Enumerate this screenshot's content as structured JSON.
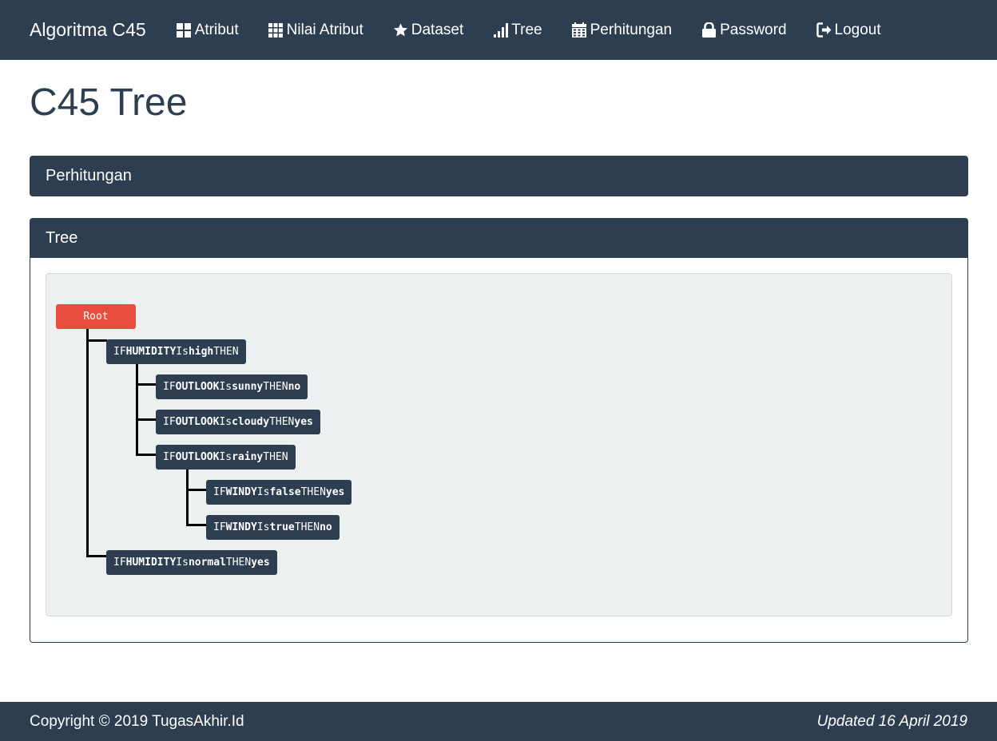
{
  "navbar": {
    "brand": "Algoritma C45",
    "items": [
      {
        "label": "Atribut",
        "icon": "grid-icon"
      },
      {
        "label": "Nilai Atribut",
        "icon": "table-icon"
      },
      {
        "label": "Dataset",
        "icon": "star-icon"
      },
      {
        "label": "Tree",
        "icon": "signal-icon"
      },
      {
        "label": "Perhitungan",
        "icon": "calendar-icon"
      },
      {
        "label": "Password",
        "icon": "lock-icon"
      },
      {
        "label": "Logout",
        "icon": "logout-icon"
      }
    ]
  },
  "page": {
    "title": "C45 Tree"
  },
  "panels": {
    "perhitungan": {
      "title": "Perhitungan"
    },
    "tree": {
      "title": "Tree"
    }
  },
  "tree": {
    "root": "Root",
    "kw_if": "IF",
    "kw_is": "Is",
    "kw_then": "THEN",
    "rules": [
      {
        "attr": "HUMIDITY",
        "value": "high",
        "result": ""
      },
      {
        "attr": "OUTLOOK",
        "value": "sunny",
        "result": "no"
      },
      {
        "attr": "OUTLOOK",
        "value": "cloudy",
        "result": "yes"
      },
      {
        "attr": "OUTLOOK",
        "value": "rainy",
        "result": ""
      },
      {
        "attr": "WINDY",
        "value": "false",
        "result": "yes"
      },
      {
        "attr": "WINDY",
        "value": "true",
        "result": "no"
      },
      {
        "attr": "HUMIDITY",
        "value": "normal",
        "result": "yes"
      }
    ]
  },
  "footer": {
    "copyright": "Copyright © 2019 TugasAkhir.Id",
    "updated": "Updated 16 April 2019"
  },
  "colors": {
    "primary": "#2c3e50",
    "root": "#e74c3c",
    "tree_bg": "#ecf0f1"
  }
}
